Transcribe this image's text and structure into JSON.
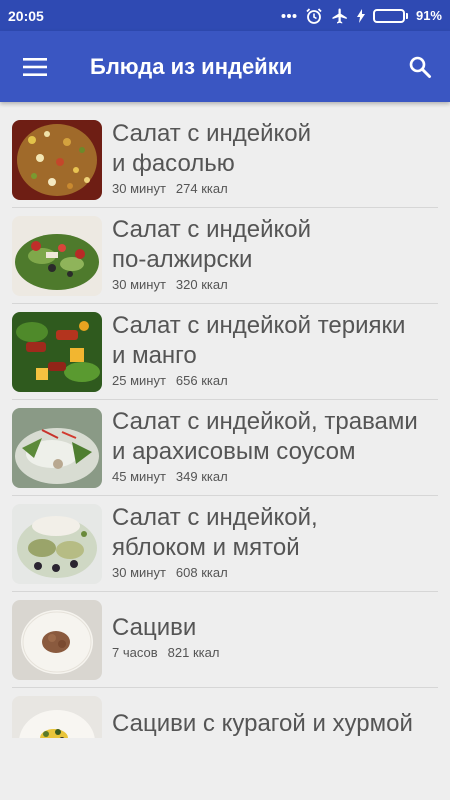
{
  "status_bar": {
    "time": "20:05",
    "battery_text": "91%",
    "battery_level": 0.91,
    "battery_color": "#5be04f"
  },
  "app_bar": {
    "title": "Блюда из индейки",
    "menu_icon": "hamburger-menu-icon",
    "search_icon": "search-icon"
  },
  "colors": {
    "status_bar": "#2f4ab3",
    "app_bar": "#3a56c2",
    "background": "#eeeeee",
    "text": "#555555"
  },
  "recipes": [
    {
      "title": "Салат с индейкой\nи фасолью",
      "time": "30 минут",
      "kcal": "274 ккал"
    },
    {
      "title": "Салат с индейкой\nпо-алжирски",
      "time": "30 минут",
      "kcal": "320 ккал"
    },
    {
      "title": "Салат с индейкой терияки\nи манго",
      "time": "25 минут",
      "kcal": "656 ккал"
    },
    {
      "title": "Салат с индейкой, травами\nи арахисовым соусом",
      "time": "45 минут",
      "kcal": "349 ккал"
    },
    {
      "title": "Салат с индейкой,\nяблоком и мятой",
      "time": "30 минут",
      "kcal": "608 ккал"
    },
    {
      "title": "Сациви",
      "time": "7 часов",
      "kcal": "821 ккал"
    },
    {
      "title": "Сациви с курагой и хурмой"
    }
  ]
}
